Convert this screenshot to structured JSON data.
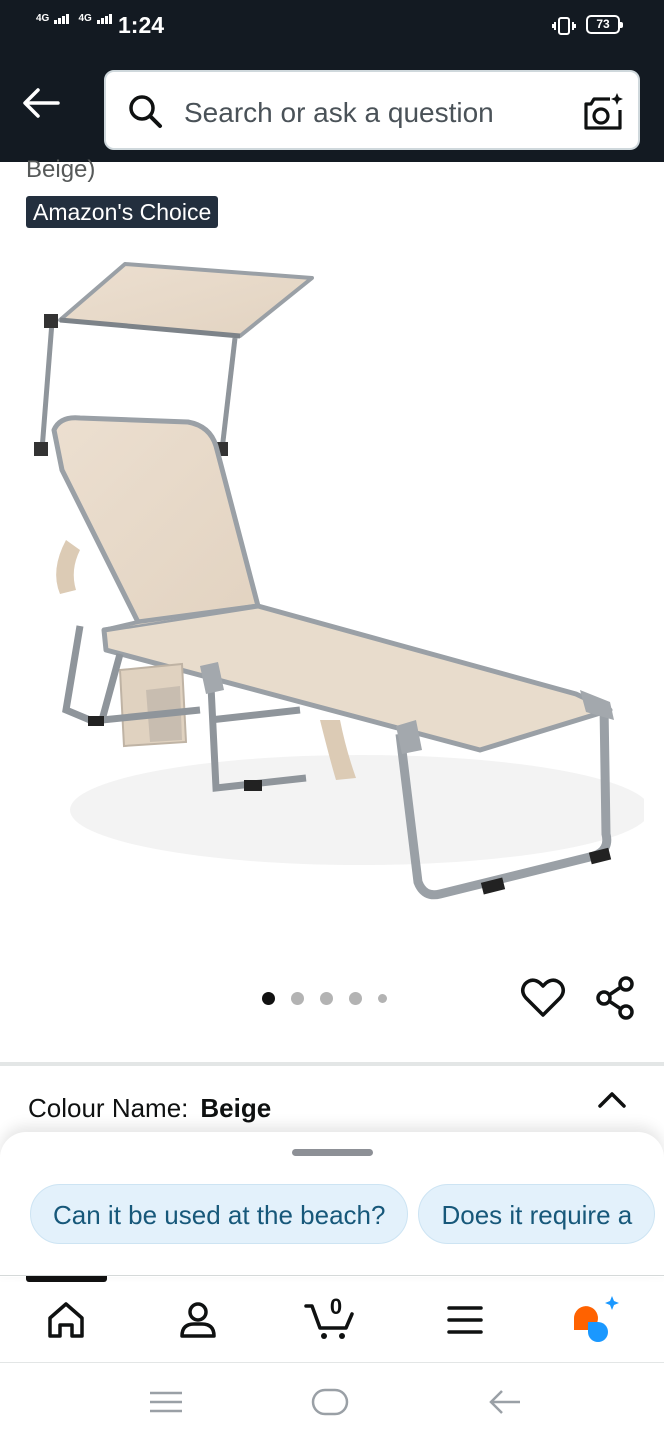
{
  "status_bar": {
    "network_1": "4G",
    "network_2": "4G",
    "time": "1:24",
    "battery": "73"
  },
  "header": {
    "search_placeholder": "Search or ask a question",
    "icons": [
      "back-arrow-icon",
      "search-icon",
      "camera-sparkle-icon"
    ]
  },
  "product": {
    "title_tail": "Beige)",
    "badge": "Amazon's Choice",
    "image_description_icon": "sun-lounger-image",
    "gallery": {
      "count": 5,
      "active_index": 0
    }
  },
  "variation": {
    "label": "Colour Name:",
    "value": "Beige"
  },
  "suggestions": {
    "chips": [
      "Can it be used at the beach?",
      "Does it require a"
    ]
  },
  "bottom_nav": {
    "items": [
      "home-icon",
      "account-icon",
      "cart-icon",
      "menu-icon",
      "rufus-icon"
    ],
    "cart_count": "0"
  },
  "colors": {
    "header_bg": "#131a22",
    "badge_bg": "#232f3e",
    "chip_bg": "#e3f1fb",
    "chip_text": "#17587a",
    "rufus_orange": "#ff6200",
    "rufus_blue": "#1a98ff"
  }
}
